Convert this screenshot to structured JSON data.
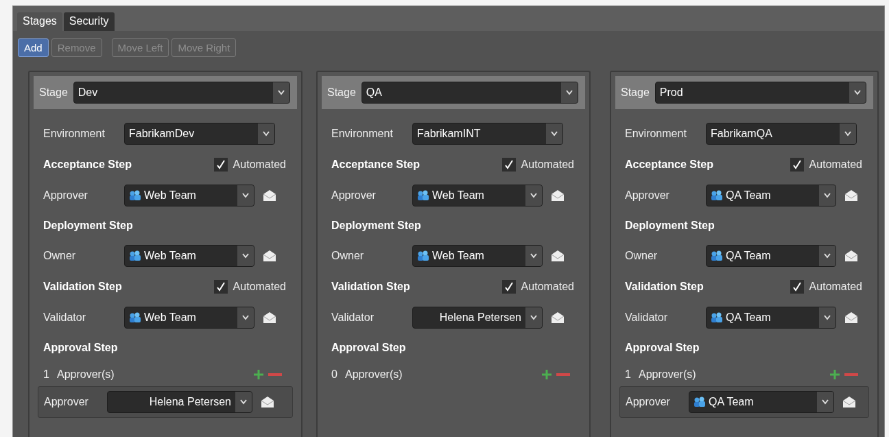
{
  "tabs": [
    {
      "label": "Stages",
      "selected": true
    },
    {
      "label": "Security",
      "selected": false
    }
  ],
  "toolbar": [
    {
      "label": "Add",
      "disabled": false
    },
    {
      "label": "Remove",
      "disabled": true
    },
    {
      "label": "Move Left",
      "disabled": true
    },
    {
      "label": "Move Right",
      "disabled": true
    }
  ],
  "stages": [
    {
      "stage_label": "Stage",
      "stage": "Dev",
      "rows": [
        {
          "kind": "select",
          "label": "Environment",
          "value": "FabrikamDev"
        },
        {
          "kind": "heading",
          "label": "Acceptance Step",
          "automated": {
            "label": "Automated",
            "checked": true
          }
        },
        {
          "kind": "picker",
          "label": "Approver",
          "value": "Web Team",
          "team": true
        },
        {
          "kind": "heading",
          "label": "Deployment Step"
        },
        {
          "kind": "picker",
          "label": "Owner",
          "value": "Web Team",
          "team": true
        },
        {
          "kind": "heading",
          "label": "Validation Step",
          "automated": {
            "label": "Automated",
            "checked": true
          }
        },
        {
          "kind": "picker",
          "label": "Validator",
          "value": "Web Team",
          "team": true
        },
        {
          "kind": "heading",
          "label": "Approval Step"
        },
        {
          "kind": "count",
          "count": "1",
          "label": "Approver(s)"
        },
        {
          "kind": "approver",
          "label": "Approver",
          "value": "Helena Petersen",
          "team": false
        }
      ]
    },
    {
      "stage_label": "Stage",
      "stage": "QA",
      "rows": [
        {
          "kind": "select",
          "label": "Environment",
          "value": "FabrikamINT"
        },
        {
          "kind": "heading",
          "label": "Acceptance Step",
          "automated": {
            "label": "Automated",
            "checked": true
          }
        },
        {
          "kind": "picker",
          "label": "Approver",
          "value": "Web Team",
          "team": true
        },
        {
          "kind": "heading",
          "label": "Deployment Step"
        },
        {
          "kind": "picker",
          "label": "Owner",
          "value": "Web Team",
          "team": true
        },
        {
          "kind": "heading",
          "label": "Validation Step",
          "automated": {
            "label": "Automated",
            "checked": true
          }
        },
        {
          "kind": "picker",
          "label": "Validator",
          "value": "Helena Petersen",
          "team": false
        },
        {
          "kind": "heading",
          "label": "Approval Step"
        },
        {
          "kind": "count",
          "count": "0",
          "label": "Approver(s)"
        }
      ]
    },
    {
      "stage_label": "Stage",
      "stage": "Prod",
      "rows": [
        {
          "kind": "select",
          "label": "Environment",
          "value": "FabrikamQA"
        },
        {
          "kind": "heading",
          "label": "Acceptance Step",
          "automated": {
            "label": "Automated",
            "checked": true
          }
        },
        {
          "kind": "picker",
          "label": "Approver",
          "value": "QA Team",
          "team": true
        },
        {
          "kind": "heading",
          "label": "Deployment Step"
        },
        {
          "kind": "picker",
          "label": "Owner",
          "value": "QA Team",
          "team": true
        },
        {
          "kind": "heading",
          "label": "Validation Step",
          "automated": {
            "label": "Automated",
            "checked": true
          }
        },
        {
          "kind": "picker",
          "label": "Validator",
          "value": "QA Team",
          "team": true
        },
        {
          "kind": "heading",
          "label": "Approval Step"
        },
        {
          "kind": "count",
          "count": "1",
          "label": "Approver(s)"
        },
        {
          "kind": "approver",
          "label": "Approver",
          "value": "QA Team",
          "team": true
        }
      ]
    }
  ]
}
